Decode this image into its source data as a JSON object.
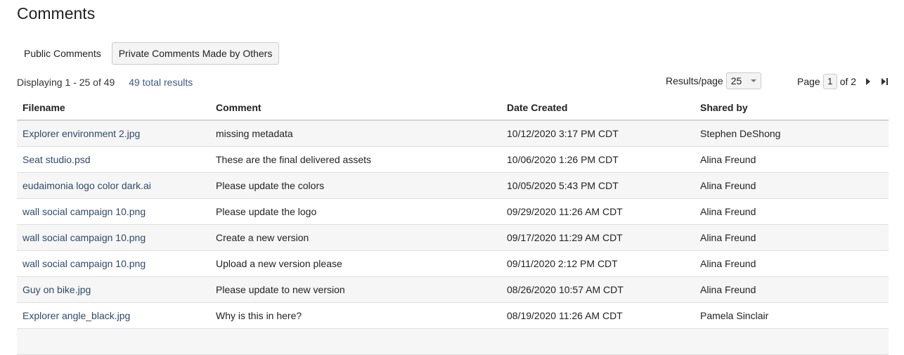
{
  "page": {
    "title": "Comments"
  },
  "tabs": [
    {
      "label": "Public Comments",
      "active": false
    },
    {
      "label": "Private Comments Made by Others",
      "active": true
    }
  ],
  "summary": {
    "displaying": "Displaying 1 - 25 of 49",
    "total": "49 total results"
  },
  "results_per_page": {
    "label": "Results/page",
    "value": "25"
  },
  "pagination": {
    "page_label": "Page",
    "current": "1",
    "of_label": "of 2"
  },
  "table": {
    "columns": [
      "Filename",
      "Comment",
      "Date Created",
      "Shared by"
    ],
    "rows": [
      {
        "filename": "Explorer environment 2.jpg",
        "comment": "missing metadata",
        "date": "10/12/2020 3:17 PM CDT",
        "shared_by": "Stephen DeShong"
      },
      {
        "filename": "Seat studio.psd",
        "comment": "These are the final delivered assets",
        "date": "10/06/2020 1:26 PM CDT",
        "shared_by": "Alina Freund"
      },
      {
        "filename": "eudaimonia logo color dark.ai",
        "comment": "Please update the colors",
        "date": "10/05/2020 5:43 PM CDT",
        "shared_by": "Alina Freund"
      },
      {
        "filename": "wall social campaign 10.png",
        "comment": "Please update the logo",
        "date": "09/29/2020 11:26 AM CDT",
        "shared_by": "Alina Freund"
      },
      {
        "filename": "wall social campaign 10.png",
        "comment": "Create a new version",
        "date": "09/17/2020 11:29 AM CDT",
        "shared_by": "Alina Freund"
      },
      {
        "filename": "wall social campaign 10.png",
        "comment": "Upload a new version please",
        "date": "09/11/2020 2:12 PM CDT",
        "shared_by": "Alina Freund"
      },
      {
        "filename": "Guy on bike.jpg",
        "comment": "Please update to new version",
        "date": "08/26/2020 10:57 AM CDT",
        "shared_by": "Alina Freund"
      },
      {
        "filename": "Explorer angle_black.jpg",
        "comment": "Why is this in here?",
        "date": "08/19/2020 11:26 AM CDT",
        "shared_by": "Pamela Sinclair"
      },
      {
        "filename": "",
        "comment": "",
        "date": "",
        "shared_by": ""
      }
    ]
  },
  "icons": {
    "next": "next-page-icon",
    "last": "last-page-icon",
    "dropdown": "chevron-down-icon"
  }
}
